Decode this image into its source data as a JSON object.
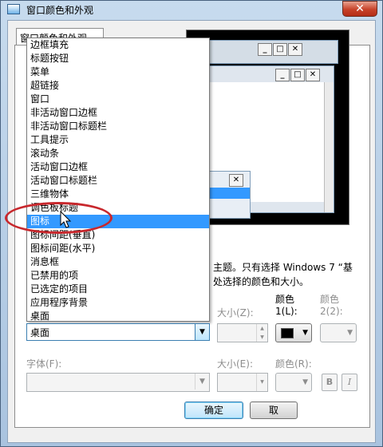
{
  "window": {
    "title": "窗口颜色和外观",
    "close_glyph": "✕"
  },
  "tab": {
    "label": "窗口颜色和外观"
  },
  "preview": {
    "buttons": [
      "_",
      "□",
      "✕"
    ],
    "close_glyph": "✕"
  },
  "item_dropdown": {
    "items": [
      "边框填充",
      "标题按钮",
      "菜单",
      "超链接",
      "窗口",
      "非活动窗口边框",
      "非活动窗口标题栏",
      "工具提示",
      "滚动条",
      "活动窗口边框",
      "活动窗口标题栏",
      "三维物体",
      "调色板标题",
      "图标",
      "图标间距(垂直)",
      "图标间距(水平)",
      "消息框",
      "已禁用的项",
      "已选定的项目",
      "应用程序背景",
      "桌面"
    ],
    "selected_index": 13
  },
  "info": {
    "line1": "主题。只有选择 Windows 7 “基",
    "line2": "处选择的颜色和大小。"
  },
  "item_combo": {
    "value": "桌面",
    "arrow": "▼"
  },
  "item_size": {
    "label": "大小(Z):"
  },
  "color1": {
    "label_line1": "颜色",
    "label_line2": "1(L):",
    "value": "#000000"
  },
  "color2": {
    "label_line1": "颜色",
    "label_line2": "2(2):"
  },
  "font_combo": {
    "label": "字体(F):"
  },
  "font_size": {
    "label": "大小(E):"
  },
  "font_color": {
    "label": "颜色(R):"
  },
  "bold_button": {
    "label": "B"
  },
  "italic_button": {
    "label": "I"
  },
  "buttons": {
    "ok": "确定",
    "cancel": "取"
  }
}
